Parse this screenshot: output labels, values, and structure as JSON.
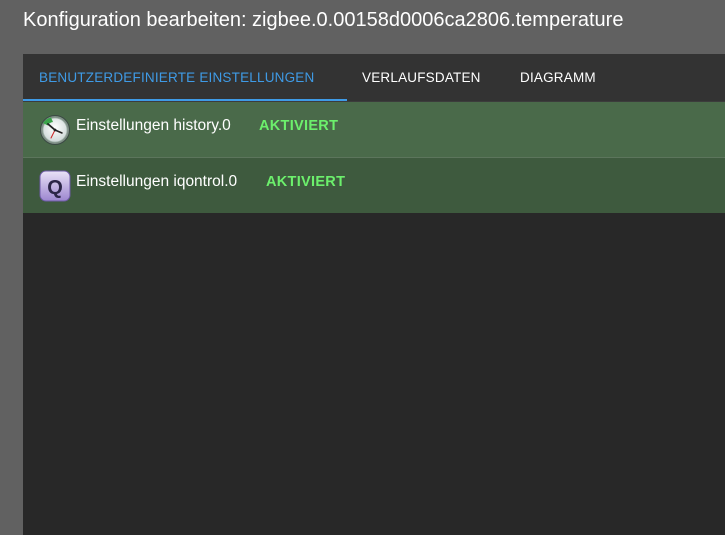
{
  "dialog": {
    "title": "Konfiguration bearbeiten: zigbee.0.00158d0006ca2806.temperature"
  },
  "tabs": [
    {
      "label": "BENUTZERDEFINIERTE EINSTELLUNGEN",
      "active": true
    },
    {
      "label": "VERLAUFSDATEN",
      "active": false
    },
    {
      "label": "DIAGRAMM",
      "active": false
    }
  ],
  "colors": {
    "accent": "#3f9be6",
    "status_enabled": "#6cf06c",
    "row_bg": "#4a6a4a"
  },
  "adapters": [
    {
      "label": "Einstellungen history.0",
      "status": "AKTIVIERT",
      "icon": "history-clock-icon"
    },
    {
      "label": "Einstellungen iqontrol.0",
      "status": "AKTIVIERT",
      "icon": "iqontrol-q-icon"
    }
  ]
}
